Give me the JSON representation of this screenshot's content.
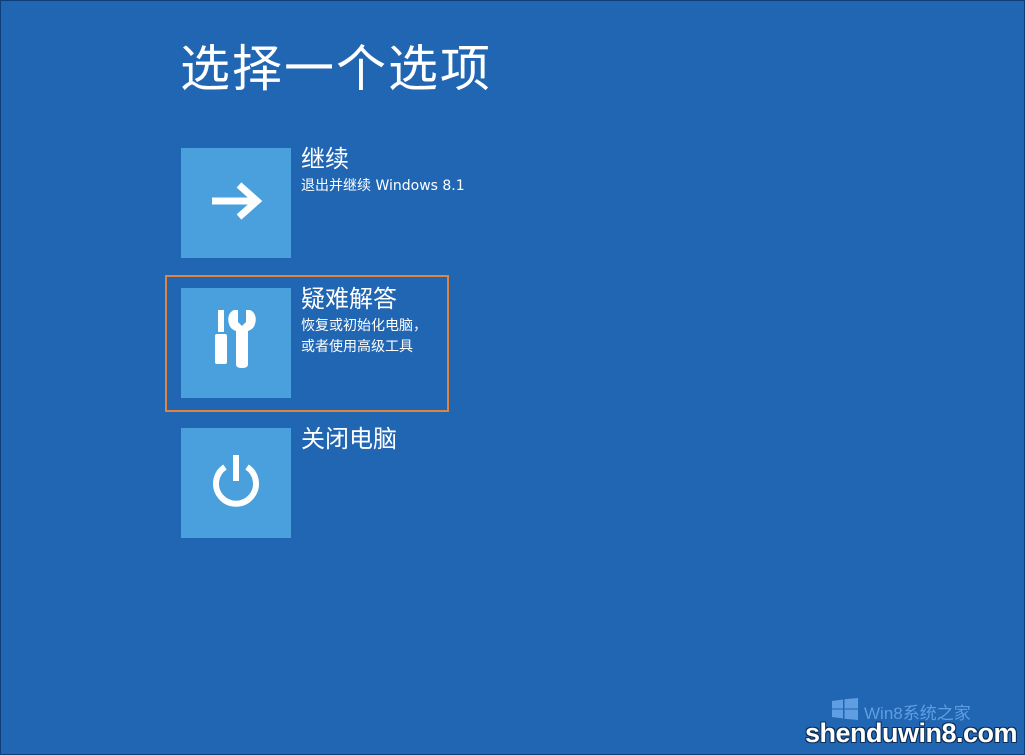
{
  "page": {
    "title": "选择一个选项",
    "background_color": "#2166b3",
    "tile_color": "#4aa0dc",
    "highlight_color": "#e0843f"
  },
  "options": [
    {
      "title": "继续",
      "description": "退出并继续 Windows 8.1",
      "icon": "arrow-right-icon"
    },
    {
      "title": "疑难解答",
      "description_line1": "恢复或初始化电脑，",
      "description_line2": "或者使用高级工具",
      "icon": "tools-icon",
      "highlighted": true
    },
    {
      "title": "关闭电脑",
      "icon": "power-icon"
    }
  ],
  "watermark": {
    "text": "Win8系统之家",
    "url": "shenduwin8.com",
    "icon": "windows-logo-icon"
  }
}
